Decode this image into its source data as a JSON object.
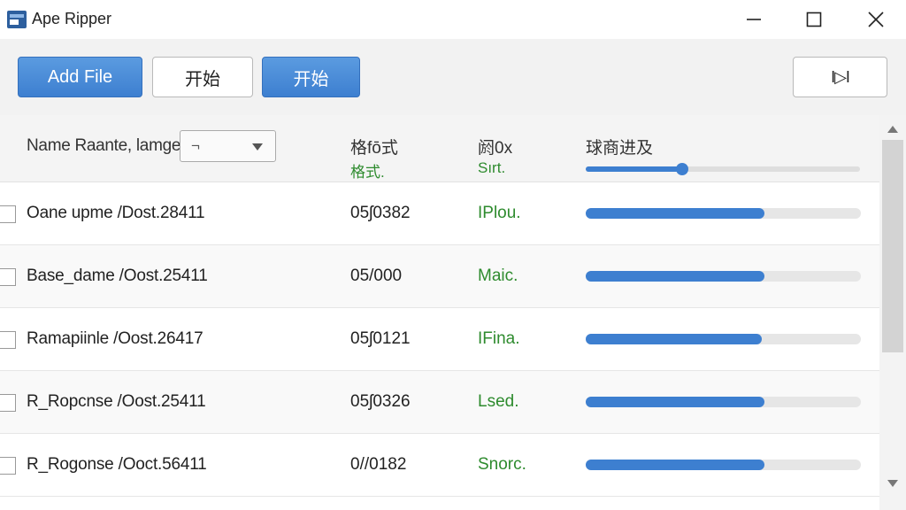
{
  "window": {
    "title": "Ape Ripper",
    "icon": "app-icon"
  },
  "toolbar": {
    "add_file": "Add File",
    "start_1": "开始",
    "start_2": "开始",
    "skip_label": "I▷I"
  },
  "header": {
    "name_label": "Name Raante, lamge",
    "select_value": "¬",
    "col2_title": "格fō式",
    "col2_sub": "格式.",
    "col3_title": "阏0x",
    "col3_sub": "Sırt.",
    "col4_title": "球商进及",
    "slider_value": 0.35
  },
  "rows": [
    {
      "name": "Oane upme /Dost.28411",
      "number": "05ʃ0382",
      "status": "IPlou.",
      "progress": 0.65
    },
    {
      "name": "Base_dame /Oost.25411",
      "number": "05/000",
      "status": "Maic.",
      "progress": 0.65
    },
    {
      "name": "Ramapiinle /Oost.26417",
      "number": "05ʃ0121",
      "status": "IFina.",
      "progress": 0.64
    },
    {
      "name": "R_Ropcnse /Oost.25411",
      "number": "05ʃ0326",
      "status": "Lsed.",
      "progress": 0.65
    },
    {
      "name": "R_Rogonse /Ooct.56411",
      "number": "0//0182",
      "status": "Snorc.",
      "progress": 0.65
    }
  ],
  "colors": {
    "accent": "#3d7fd0",
    "status_green": "#2e8b2e",
    "toolbar_bg": "#f2f2f2"
  }
}
